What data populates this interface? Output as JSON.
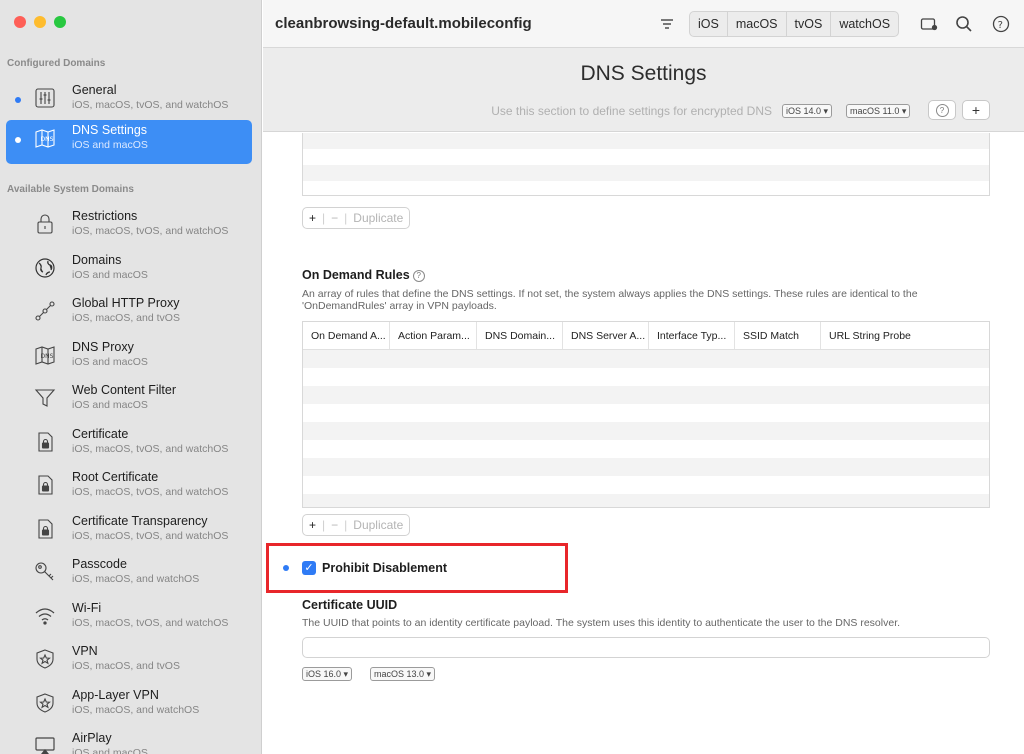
{
  "sidebar": {
    "configured_label": "Configured Domains",
    "available_label": "Available System Domains",
    "configured": [
      {
        "name": "General",
        "platforms": "iOS, macOS, tvOS, and watchOS",
        "icon": "sliders-icon"
      },
      {
        "name": "DNS Settings",
        "platforms": "iOS and macOS",
        "icon": "dns-map-icon"
      }
    ],
    "available": [
      {
        "name": "Restrictions",
        "platforms": "iOS, macOS, tvOS, and watchOS",
        "icon": "lock-icon"
      },
      {
        "name": "Domains",
        "platforms": "iOS and macOS",
        "icon": "globe-icon"
      },
      {
        "name": "Global HTTP Proxy",
        "platforms": "iOS, macOS, and tvOS",
        "icon": "proxy-icon"
      },
      {
        "name": "DNS Proxy",
        "platforms": "iOS and macOS",
        "icon": "dns-map-icon"
      },
      {
        "name": "Web Content Filter",
        "platforms": "iOS and macOS",
        "icon": "funnel-icon"
      },
      {
        "name": "Certificate",
        "platforms": "iOS, macOS, tvOS, and watchOS",
        "icon": "certificate-icon"
      },
      {
        "name": "Root Certificate",
        "platforms": "iOS, macOS, tvOS, and watchOS",
        "icon": "certificate-icon"
      },
      {
        "name": "Certificate Transparency",
        "platforms": "iOS, macOS, tvOS, and watchOS",
        "icon": "certificate-icon"
      },
      {
        "name": "Passcode",
        "platforms": "iOS, macOS, and watchOS",
        "icon": "key-icon"
      },
      {
        "name": "Wi-Fi",
        "platforms": "iOS, macOS, tvOS, and watchOS",
        "icon": "wifi-icon"
      },
      {
        "name": "VPN",
        "platforms": "iOS, macOS, and tvOS",
        "icon": "shield-icon"
      },
      {
        "name": "App-Layer VPN",
        "platforms": "iOS, macOS, and watchOS",
        "icon": "shield-icon"
      },
      {
        "name": "AirPlay",
        "platforms": "iOS and macOS",
        "icon": "airplay-icon"
      }
    ]
  },
  "toolbar": {
    "title": "cleanbrowsing-default.mobileconfig",
    "platforms": [
      "iOS",
      "macOS",
      "tvOS",
      "watchOS"
    ]
  },
  "header": {
    "title": "DNS Settings",
    "subtitle": "Use this section to define settings for encrypted DNS",
    "ios_version": "iOS 14.0",
    "macos_version": "macOS 11.0",
    "help_label": "?",
    "add_label": "+"
  },
  "buttons": {
    "add": "+",
    "remove": "−",
    "duplicate": "Duplicate"
  },
  "on_demand": {
    "title": "On Demand Rules",
    "description": "An array of rules that define the DNS settings. If not set, the system always applies the DNS settings. These rules are identical to the 'OnDemandRules' array in VPN payloads.",
    "columns": [
      "On Demand A...",
      "Action Param...",
      "DNS Domain...",
      "DNS Server A...",
      "Interface Typ...",
      "SSID Match",
      "URL String Probe"
    ]
  },
  "prohibit": {
    "label": "Prohibit Disablement",
    "checked": true
  },
  "certificate_uuid": {
    "title": "Certificate UUID",
    "description": "The UUID that points to an identity certificate payload. The system uses this identity to authenticate the user to the DNS resolver.",
    "value": "",
    "ios_version": "iOS 16.0",
    "macos_version": "macOS 13.0"
  },
  "colors": {
    "accent": "#2f7bf5",
    "highlight": "#e8262a",
    "close": "#fe5f57",
    "minimize": "#febc2e",
    "zoom": "#28c840"
  }
}
